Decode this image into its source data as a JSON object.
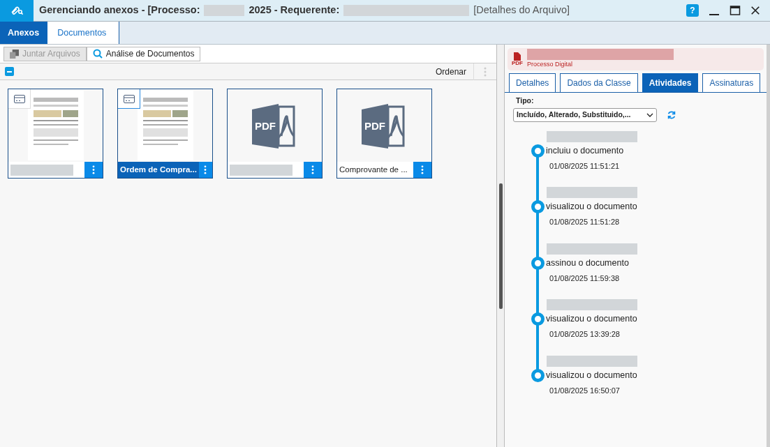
{
  "window": {
    "title_parts": [
      "Gerenciando anexos - [Processo:",
      "2025 - Requerente:",
      "[Detalhes do Arquivo]"
    ],
    "help": "?"
  },
  "breadcrumb": [
    {
      "label": "Anexos",
      "selected": false
    },
    {
      "label": "Documentos",
      "selected": true
    }
  ],
  "toolbar": [
    {
      "label": "Juntar Arquivos",
      "disabled": true,
      "kind": "merge"
    },
    {
      "label": "Análise de Documentos",
      "disabled": false,
      "kind": "search"
    }
  ],
  "list_header": {
    "sort_label": "Ordenar"
  },
  "files": [
    {
      "kind": "scan",
      "selected": false,
      "flagged": true
    },
    {
      "kind": "scan",
      "name": "Ordem de Compra...",
      "selected": true,
      "flagged": true
    },
    {
      "kind": "pdf",
      "icon_label": "PDF",
      "selected": false,
      "flagged": false
    },
    {
      "kind": "pdf",
      "icon_label": "PDF",
      "name": "Comprovante de ...",
      "selected": false,
      "flagged": false
    }
  ],
  "file_header": {
    "badge": "PDF",
    "subtitle": "Processo Digital"
  },
  "tabs": [
    {
      "label": "Detalhes",
      "selected": false
    },
    {
      "label": "Dados da Classe",
      "selected": false
    },
    {
      "label": "Atividades",
      "selected": true
    },
    {
      "label": "Assinaturas",
      "selected": false
    }
  ],
  "filter": {
    "label": "Tipo:",
    "value": "Incluído, Alterado, Substituido,..."
  },
  "activities": [
    {
      "action": "incluiu o documento",
      "time": "01/08/2025 11:51:21"
    },
    {
      "action": "visualizou o documento",
      "time": "01/08/2025 11:51:28"
    },
    {
      "action": "assinou o documento",
      "time": "01/08/2025 11:59:38"
    },
    {
      "action": "visualizou o documento",
      "time": "01/08/2025 13:39:28"
    },
    {
      "action": "visualizou o documento",
      "time": "01/08/2025 16:50:07"
    }
  ]
}
